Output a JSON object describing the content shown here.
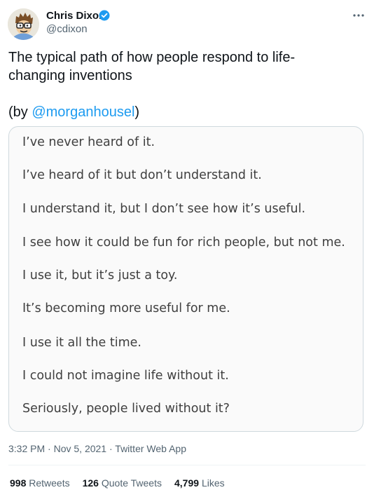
{
  "author": {
    "name": "Chris Dixon",
    "handle": "@cdixon"
  },
  "tweet": {
    "text_line1": "The typical path of how people respond to life-",
    "text_line2": "changing inventions",
    "credit_open": "(by ",
    "credit_mention": "@morganhousel",
    "credit_close": ")"
  },
  "media_lines": [
    "I’ve never heard of it.",
    "I’ve heard of it but don’t understand it.",
    "I understand it, but I don’t see how it’s useful.",
    "I see how it could be fun for rich people, but not me.",
    "I use it, but it’s just a toy.",
    "It’s becoming more useful for me.",
    "I use it all the time.",
    "I could not imagine life without it.",
    "Seriously, people lived without it?"
  ],
  "meta": {
    "time": "3:32 PM",
    "separator": " · ",
    "date": "Nov 5, 2021",
    "source": "Twitter Web App"
  },
  "stats": {
    "retweets_count": "998",
    "retweets_label": "Retweets",
    "quotes_count": "126",
    "quotes_label": "Quote Tweets",
    "likes_count": "4,799",
    "likes_label": "Likes"
  },
  "colors": {
    "accent": "#1d9bf0",
    "text_primary": "#0f1419",
    "text_secondary": "#536471"
  },
  "icons": {
    "verified": "verified-badge-icon",
    "more": "more-options-icon",
    "avatar": "cartoon-avatar"
  }
}
